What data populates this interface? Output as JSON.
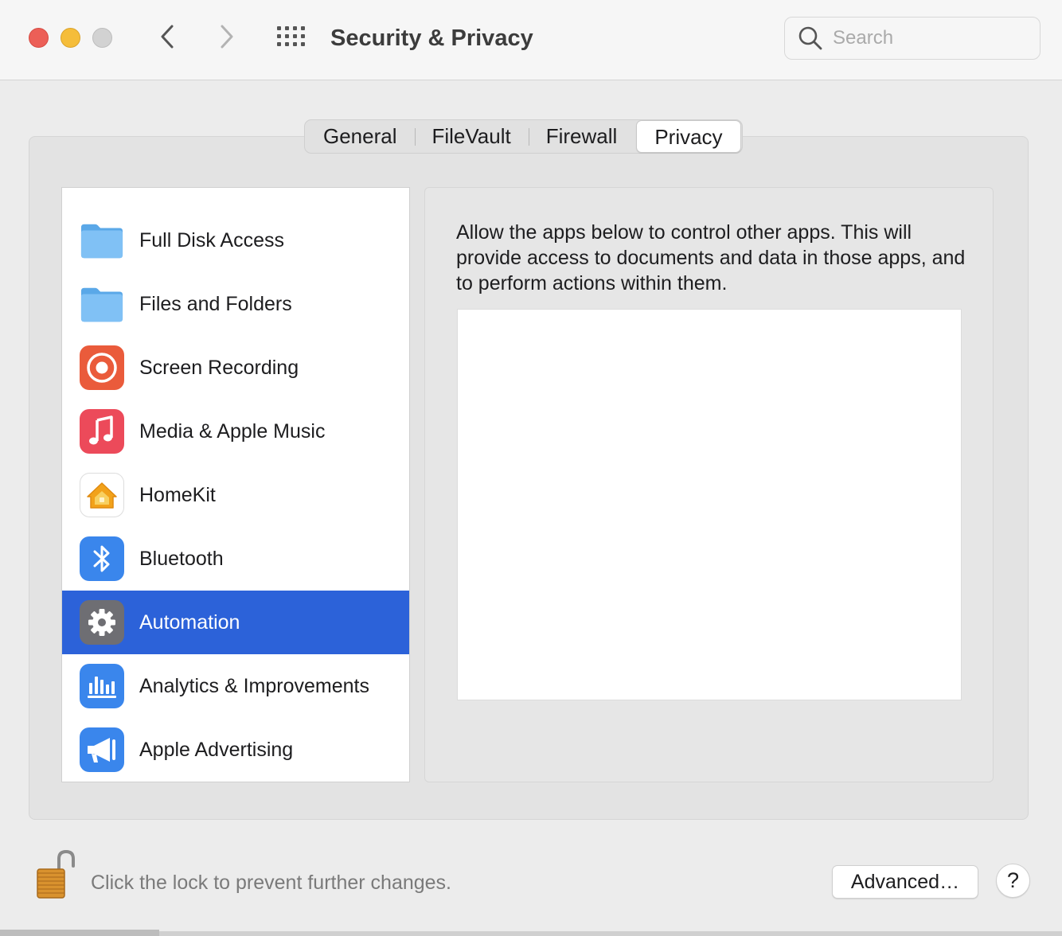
{
  "window": {
    "title": "Security & Privacy"
  },
  "toolbar": {
    "back_icon": "chevron-left-icon",
    "forward_icon": "chevron-right-icon",
    "grid_icon": "show-all-grid-icon"
  },
  "search": {
    "placeholder": "Search",
    "value": ""
  },
  "tabs": [
    {
      "label": "General",
      "active": false
    },
    {
      "label": "FileVault",
      "active": false
    },
    {
      "label": "Firewall",
      "active": false
    },
    {
      "label": "Privacy",
      "active": true
    }
  ],
  "sidebar": {
    "items": [
      {
        "label": "Full Disk Access",
        "icon": "folder-icon",
        "selected": false
      },
      {
        "label": "Files and Folders",
        "icon": "folder-icon",
        "selected": false
      },
      {
        "label": "Screen Recording",
        "icon": "screen-recording-icon",
        "selected": false
      },
      {
        "label": "Media & Apple Music",
        "icon": "music-note-icon",
        "selected": false
      },
      {
        "label": "HomeKit",
        "icon": "homekit-house-icon",
        "selected": false
      },
      {
        "label": "Bluetooth",
        "icon": "bluetooth-icon",
        "selected": false
      },
      {
        "label": "Automation",
        "icon": "gear-icon",
        "selected": true
      },
      {
        "label": "Analytics & Improvements",
        "icon": "analytics-bars-icon",
        "selected": false
      },
      {
        "label": "Apple Advertising",
        "icon": "megaphone-icon",
        "selected": false
      }
    ]
  },
  "detail": {
    "description": "Allow the apps below to control other apps. This will provide access to documents and data in those apps, and to perform actions within them."
  },
  "footer": {
    "lock_text": "Click the lock to prevent further changes.",
    "advanced_label": "Advanced…",
    "help_label": "?"
  },
  "colors": {
    "selection": "#2c62d9",
    "close": "#ec5f57",
    "minimize": "#f5bd3a",
    "zoom": "#d2d2d2"
  }
}
